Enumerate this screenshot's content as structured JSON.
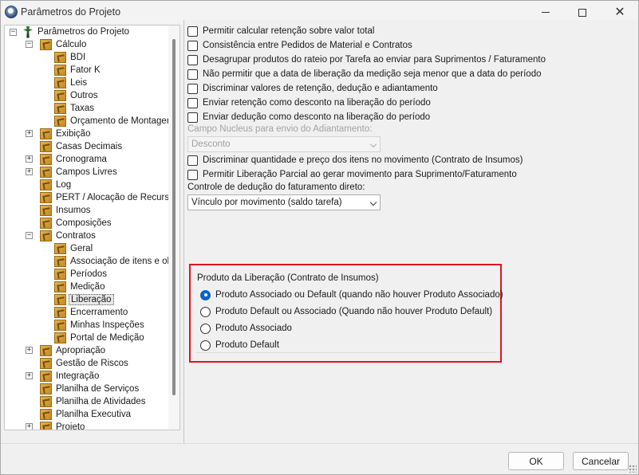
{
  "window": {
    "title": "Parâmetros do Projeto"
  },
  "tree": {
    "root": "Parâmetros do Projeto",
    "items": [
      {
        "label": "Cálculo",
        "level": 1,
        "expander": "-"
      },
      {
        "label": "BDI",
        "level": 2,
        "expander": ""
      },
      {
        "label": "Fator K",
        "level": 2,
        "expander": ""
      },
      {
        "label": "Leis",
        "level": 2,
        "expander": ""
      },
      {
        "label": "Outros",
        "level": 2,
        "expander": ""
      },
      {
        "label": "Taxas",
        "level": 2,
        "expander": ""
      },
      {
        "label": "Orçamento de Montagem",
        "level": 2,
        "expander": ""
      },
      {
        "label": "Exibição",
        "level": 1,
        "expander": "+"
      },
      {
        "label": "Casas Decimais",
        "level": 1,
        "expander": ""
      },
      {
        "label": "Cronograma",
        "level": 1,
        "expander": "+"
      },
      {
        "label": "Campos Livres",
        "level": 1,
        "expander": "+"
      },
      {
        "label": "Log",
        "level": 1,
        "expander": ""
      },
      {
        "label": "PERT / Alocação de Recursos",
        "level": 1,
        "expander": ""
      },
      {
        "label": "Insumos",
        "level": 1,
        "expander": ""
      },
      {
        "label": "Composições",
        "level": 1,
        "expander": ""
      },
      {
        "label": "Contratos",
        "level": 1,
        "expander": "-"
      },
      {
        "label": "Geral",
        "level": 2,
        "expander": ""
      },
      {
        "label": "Associação de itens e ob",
        "level": 2,
        "expander": ""
      },
      {
        "label": "Períodos",
        "level": 2,
        "expander": ""
      },
      {
        "label": "Medição",
        "level": 2,
        "expander": ""
      },
      {
        "label": "Liberação",
        "level": 2,
        "expander": "",
        "selected": true
      },
      {
        "label": "Encerramento",
        "level": 2,
        "expander": ""
      },
      {
        "label": "Minhas Inspeções",
        "level": 2,
        "expander": ""
      },
      {
        "label": "Portal de Medição",
        "level": 2,
        "expander": ""
      },
      {
        "label": "Apropriação",
        "level": 1,
        "expander": "+"
      },
      {
        "label": "Gestão de Riscos",
        "level": 1,
        "expander": ""
      },
      {
        "label": "Integração",
        "level": 1,
        "expander": "+"
      },
      {
        "label": "Planilha de Serviços",
        "level": 1,
        "expander": ""
      },
      {
        "label": "Planilha de Atividades",
        "level": 1,
        "expander": ""
      },
      {
        "label": "Planilha Executiva",
        "level": 1,
        "expander": ""
      },
      {
        "label": "Projeto",
        "level": 1,
        "expander": "+"
      }
    ]
  },
  "options": {
    "c1": "Permitir calcular retenção sobre valor total",
    "c2": "Consistência entre Pedidos de Material e Contratos",
    "c3": "Desagrupar produtos do rateio por Tarefa ao enviar para Suprimentos / Faturamento",
    "c4": "Não permitir que a data de liberação da medição seja menor que a data do período",
    "c5": "Discriminar valores de retenção, dedução e adiantamento",
    "c6": "Enviar retenção como desconto na liberação do período",
    "c7": "Enviar dedução como desconto na liberação do período",
    "nucleus_label": "Campo Nucleus para envio do Adiantamento:",
    "nucleus_value": "Desconto",
    "c8": "Discriminar quantidade e preço dos itens no movimento (Contrato de Insumos)",
    "c9": "Permitir Liberação Parcial ao gerar movimento para Suprimento/Faturamento",
    "controle_label": "Controle de dedução do faturamento direto:",
    "controle_value": "Vínculo por movimento (saldo tarefa)"
  },
  "produto_group": {
    "title": "Produto da Liberação (Contrato de Insumos)",
    "r1": "Produto Associado ou Default (quando não houver Produto Associado)",
    "r2": "Produto Default ou Associado (Quando não houver Produto Default)",
    "r3": "Produto Associado",
    "r4": "Produto Default",
    "selected": "r1"
  },
  "footer": {
    "ok": "OK",
    "cancel": "Cancelar"
  },
  "colors": {
    "highlight": "#e0141e",
    "radio_selected": "#0a63c9"
  }
}
